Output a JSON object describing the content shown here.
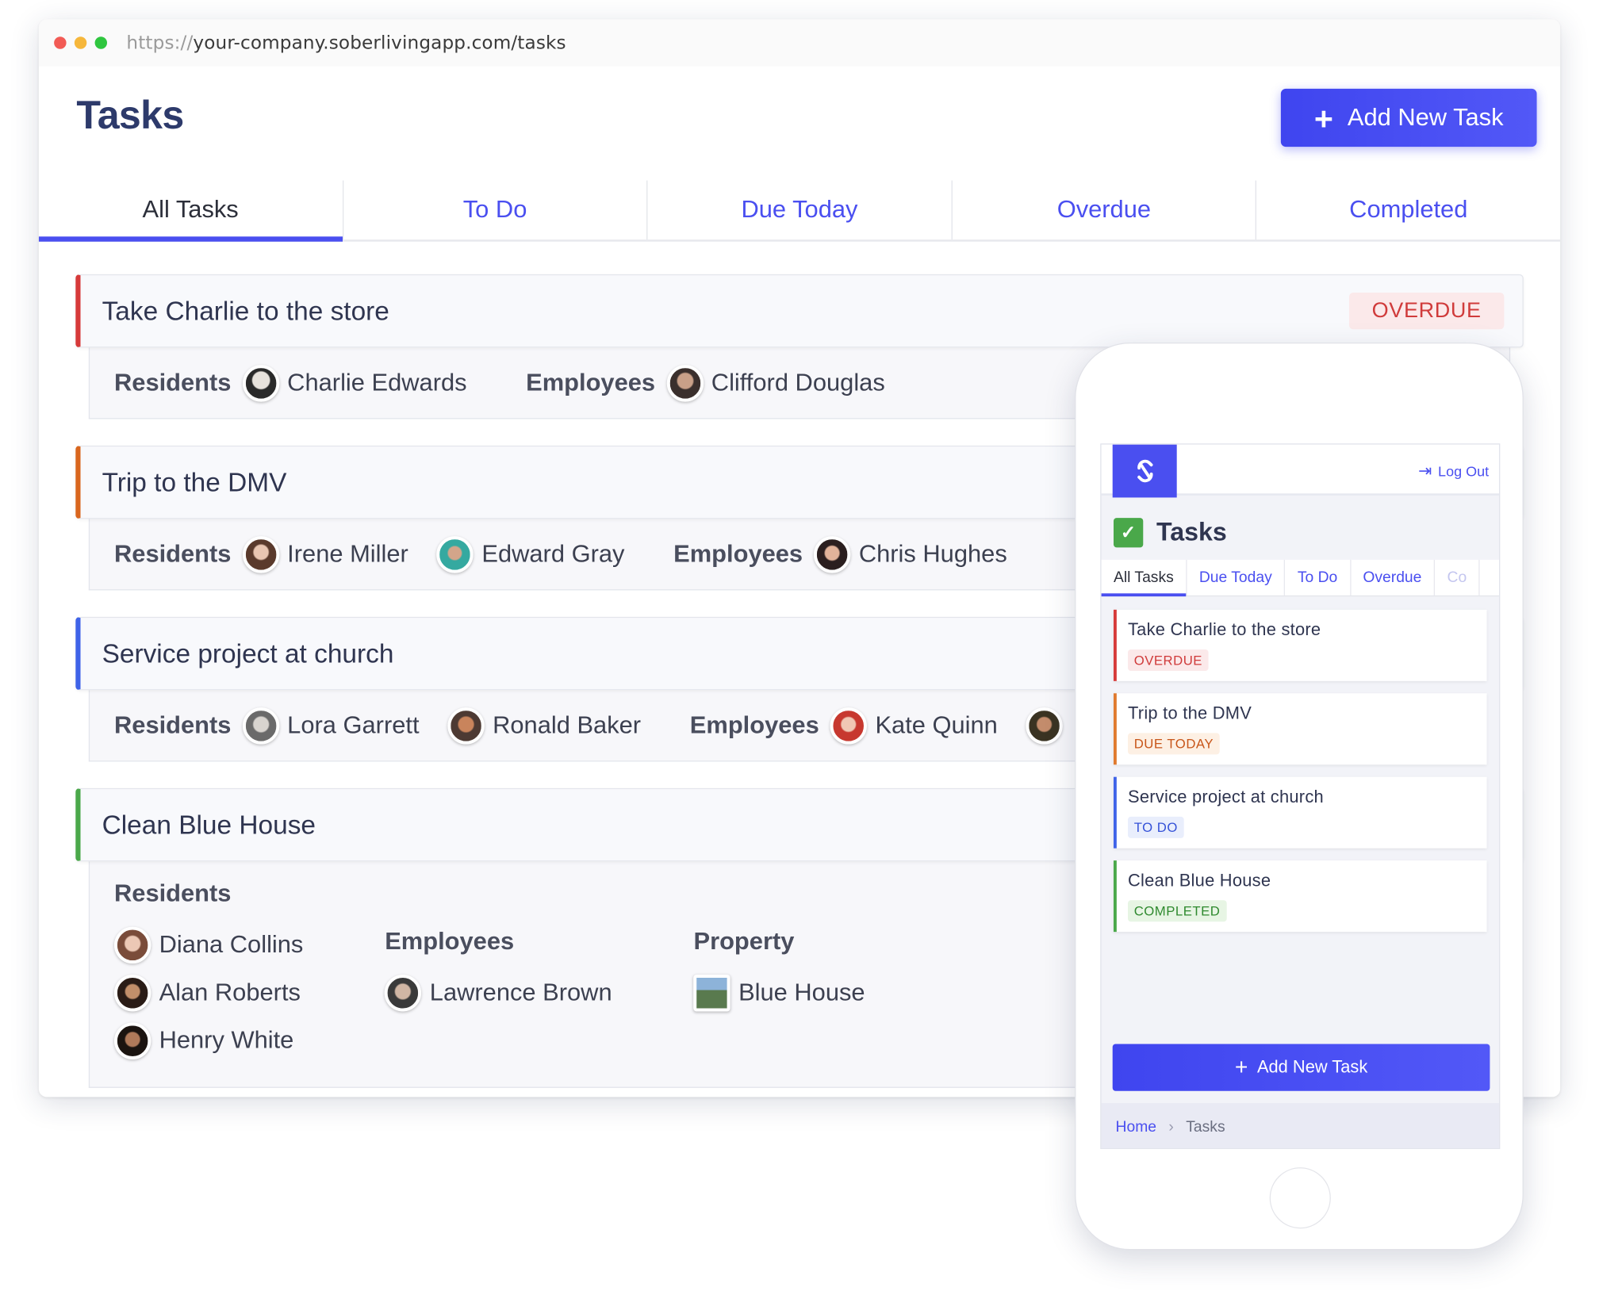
{
  "browser": {
    "url_protocol": "https://",
    "url_rest": "your-company.soberlivingapp.com/tasks"
  },
  "page": {
    "title": "Tasks",
    "add_label": "Add New Task"
  },
  "tabs": [
    "All Tasks",
    "To Do",
    "Due Today",
    "Overdue",
    "Completed"
  ],
  "labels": {
    "residents": "Residents",
    "employees": "Employees",
    "property": "Property"
  },
  "tasks": [
    {
      "title": "Take Charlie to the store",
      "status": "OVERDUE",
      "color": "#d63a3a",
      "residents": [
        "Charlie Edwards"
      ],
      "employees": [
        "Clifford Douglas"
      ]
    },
    {
      "title": "Trip to the DMV",
      "color": "#d9661e",
      "residents": [
        "Irene Miller",
        "Edward Gray"
      ],
      "employees": [
        "Chris Hughes"
      ]
    },
    {
      "title": "Service project at church",
      "color": "#3f63e8",
      "residents": [
        "Lora Garrett",
        "Ronald Baker"
      ],
      "employees": [
        "Kate Quinn"
      ]
    },
    {
      "title": "Clean Blue House",
      "color": "#4aa84a",
      "residents": [
        "Diana Collins",
        "Alan Roberts",
        "Henry White"
      ],
      "employees": [
        "Lawrence Brown"
      ],
      "property": [
        "Blue House"
      ]
    }
  ],
  "mobile": {
    "logout": "Log Out",
    "title": "Tasks",
    "tabs": [
      "All Tasks",
      "Due Today",
      "To Do",
      "Overdue",
      "Co"
    ],
    "cards": [
      {
        "title": "Take Charlie to the store",
        "badge": "OVERDUE",
        "color": "#d63a3a",
        "badge_bg": "#fbe9ea",
        "badge_fg": "#d03b3b"
      },
      {
        "title": "Trip to the DMV",
        "badge": "DUE TODAY",
        "color": "#e07a2e",
        "badge_bg": "#fdf0e4",
        "badge_fg": "#c8561a"
      },
      {
        "title": "Service project at church",
        "badge": "TO DO",
        "color": "#3f63e8",
        "badge_bg": "#e9eefc",
        "badge_fg": "#3552d8"
      },
      {
        "title": "Clean Blue House",
        "badge": "COMPLETED",
        "color": "#4aa84a",
        "badge_bg": "#e7f5e4",
        "badge_fg": "#2f8a2f"
      }
    ],
    "add_label": "Add New Task",
    "breadcrumb": {
      "home": "Home",
      "current": "Tasks"
    }
  }
}
